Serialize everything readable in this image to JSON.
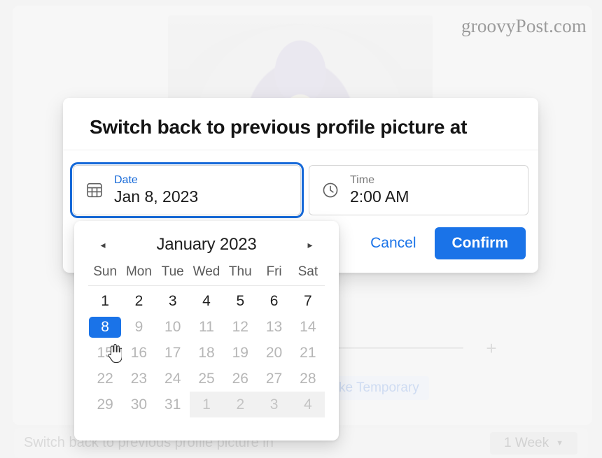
{
  "watermark": "groovyPost.com",
  "background": {
    "divider_label": "",
    "plus_icon": "plus-icon",
    "make_temporary_label": "ke Temporary",
    "bottom_label": "Switch back to previous profile picture in",
    "week_dropdown_value": "1 Week",
    "week_dropdown_caret": "▼"
  },
  "dialog": {
    "title": "Switch back to previous profile picture at",
    "date_field": {
      "icon": "calendar-icon",
      "label": "Date",
      "value": "Jan 8, 2023"
    },
    "time_field": {
      "icon": "clock-icon",
      "label": "Time",
      "value": "2:00 AM"
    },
    "cancel_label": "Cancel",
    "confirm_label": "Confirm"
  },
  "calendar": {
    "prev_icon": "◂",
    "next_icon": "▸",
    "month_label": "January 2023",
    "weekdays": [
      "Sun",
      "Mon",
      "Tue",
      "Wed",
      "Thu",
      "Fri",
      "Sat"
    ],
    "selected_day": 8,
    "days": [
      {
        "d": "1",
        "state": "normal"
      },
      {
        "d": "2",
        "state": "normal"
      },
      {
        "d": "3",
        "state": "normal"
      },
      {
        "d": "4",
        "state": "normal"
      },
      {
        "d": "5",
        "state": "normal"
      },
      {
        "d": "6",
        "state": "normal"
      },
      {
        "d": "7",
        "state": "normal"
      },
      {
        "d": "8",
        "state": "selected"
      },
      {
        "d": "9",
        "state": "dim"
      },
      {
        "d": "10",
        "state": "dim"
      },
      {
        "d": "11",
        "state": "dim"
      },
      {
        "d": "12",
        "state": "dim"
      },
      {
        "d": "13",
        "state": "dim"
      },
      {
        "d": "14",
        "state": "dim"
      },
      {
        "d": "15",
        "state": "dim"
      },
      {
        "d": "16",
        "state": "dim"
      },
      {
        "d": "17",
        "state": "dim"
      },
      {
        "d": "18",
        "state": "dim"
      },
      {
        "d": "19",
        "state": "dim"
      },
      {
        "d": "20",
        "state": "dim"
      },
      {
        "d": "21",
        "state": "dim"
      },
      {
        "d": "22",
        "state": "dim"
      },
      {
        "d": "23",
        "state": "dim"
      },
      {
        "d": "24",
        "state": "dim"
      },
      {
        "d": "25",
        "state": "dim"
      },
      {
        "d": "26",
        "state": "dim"
      },
      {
        "d": "27",
        "state": "dim"
      },
      {
        "d": "28",
        "state": "dim"
      },
      {
        "d": "29",
        "state": "dim"
      },
      {
        "d": "30",
        "state": "dim"
      },
      {
        "d": "31",
        "state": "dim"
      },
      {
        "d": "1",
        "state": "outside"
      },
      {
        "d": "2",
        "state": "outside"
      },
      {
        "d": "3",
        "state": "outside"
      },
      {
        "d": "4",
        "state": "outside"
      }
    ]
  },
  "colors": {
    "accent_blue": "#1a73e8",
    "focus_blue": "#1669d8",
    "page_bg": "#f4f4f4",
    "dim_text": "#b6b6b6"
  }
}
